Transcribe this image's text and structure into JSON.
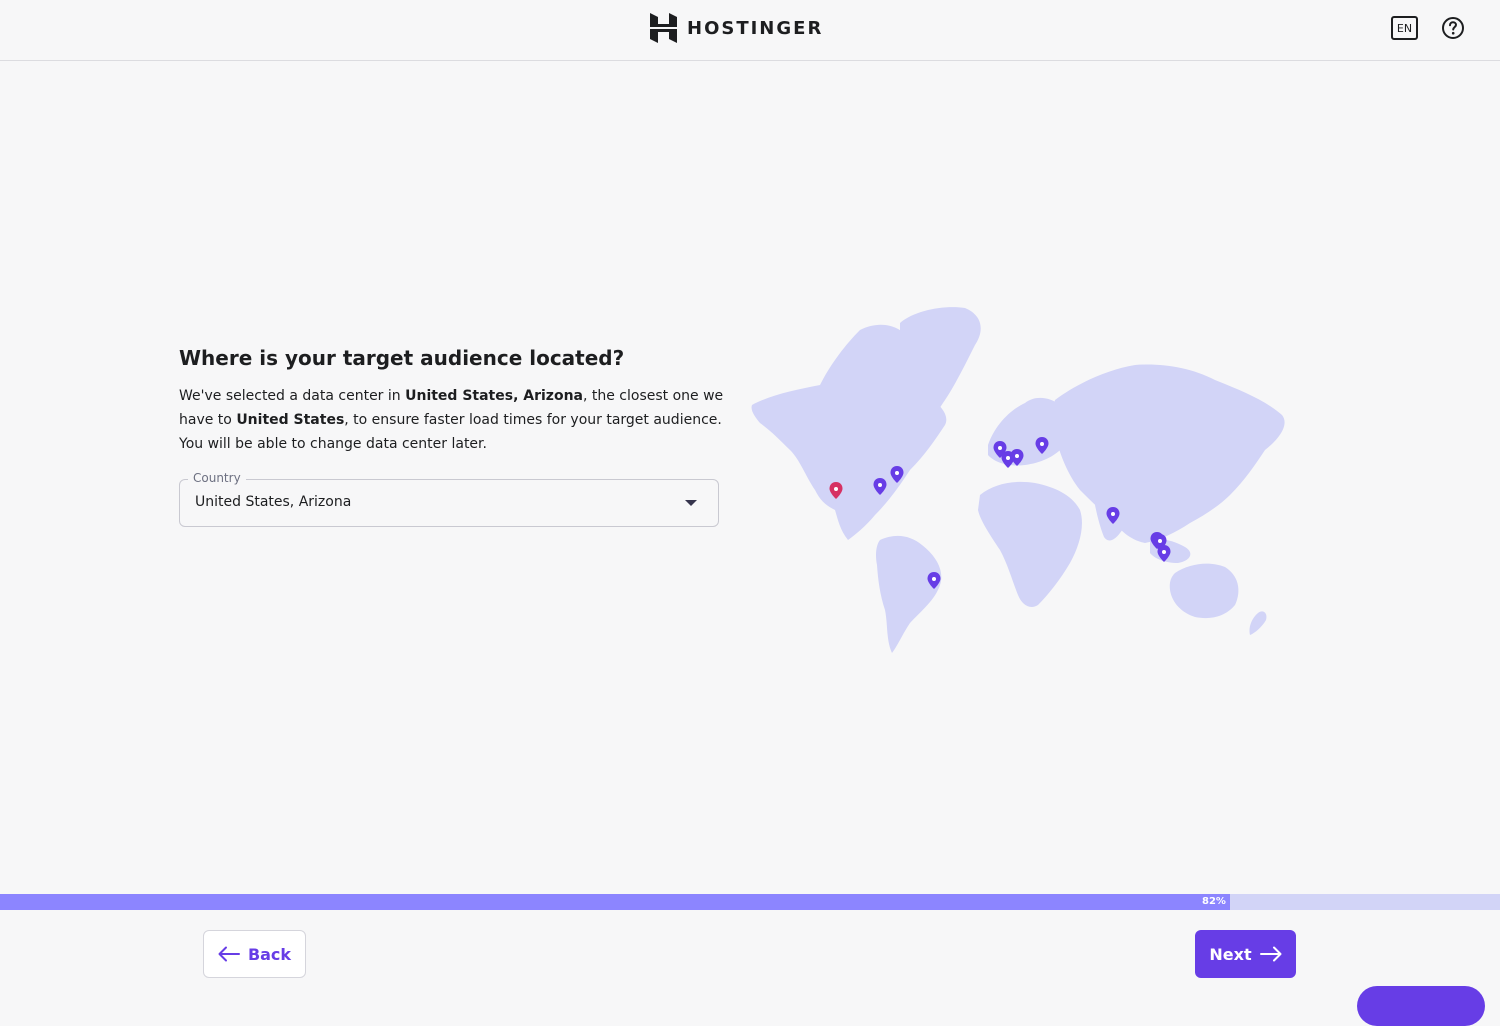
{
  "header": {
    "brand": "HOSTINGER",
    "language": "EN",
    "help_icon": "question-circle-icon"
  },
  "main": {
    "title": "Where is your target audience located?",
    "description": {
      "part1": "We've selected a data center in ",
      "datacenter": "United States, Arizona",
      "part2": ", the closest one we have to ",
      "country": "United States",
      "part3": ", to ensure faster load times for your target audience. You will be able to change data center later."
    },
    "country_select": {
      "label": "Country",
      "value": "United States, Arizona"
    }
  },
  "map": {
    "selected_pin_color": "#d63163",
    "pin_color": "#673de6",
    "land_color": "#d2d4f7"
  },
  "progress": {
    "percent": 82,
    "label": "82%"
  },
  "footer": {
    "back_label": "Back",
    "next_label": "Next"
  },
  "colors": {
    "primary": "#673de6",
    "progress_fill": "#8c85ff",
    "progress_track": "#d2d4f7"
  }
}
